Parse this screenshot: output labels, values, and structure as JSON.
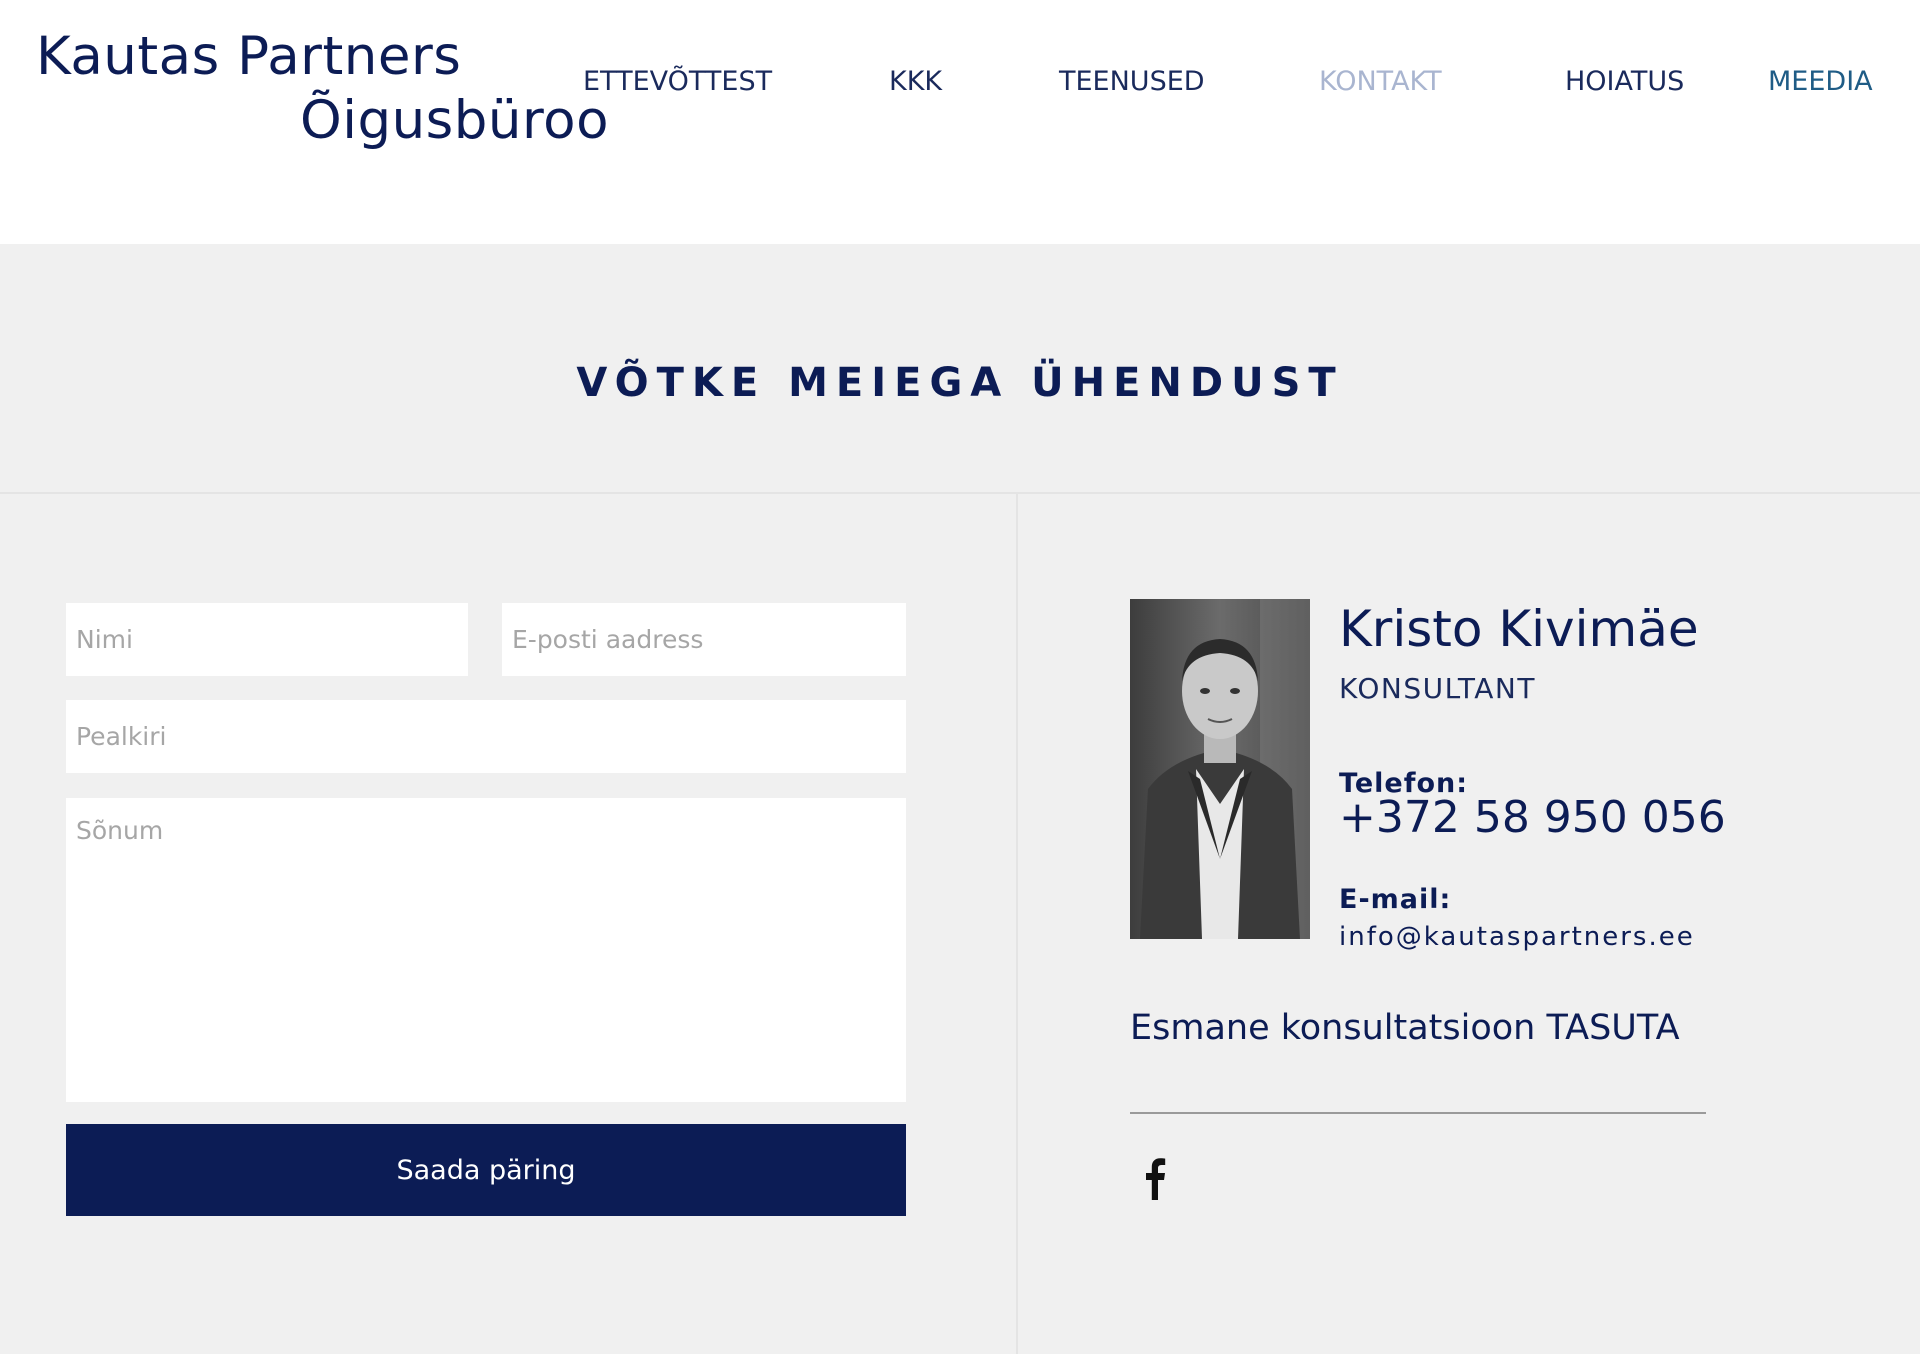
{
  "brand": {
    "line1": "Kautas Partners",
    "line2": "Õigusbüroo"
  },
  "nav": {
    "items": [
      {
        "label": "ETTEVÕTTEST"
      },
      {
        "label": "KKK"
      },
      {
        "label": "TEENUSED"
      },
      {
        "label": "KONTAKT"
      },
      {
        "label": "HOIATUS"
      },
      {
        "label": "MEEDIA"
      }
    ],
    "active_index": 3
  },
  "section": {
    "title": "VÕTKE MEIEGA ÜHENDUST"
  },
  "form": {
    "name_placeholder": "Nimi",
    "email_placeholder": "E-posti aadress",
    "subject_placeholder": "Pealkiri",
    "message_placeholder": "Sõnum",
    "submit_label": "Saada päring"
  },
  "contact": {
    "name": "Kristo Kivimäe",
    "role": "KONSULTANT",
    "phone_label": "Telefon:",
    "phone": "+372 58 950 056",
    "email_label": "E-mail:",
    "email": "info@kautaspartners.ee",
    "promo": "Esmane konsultatsioon TASUTA",
    "social_icon": "facebook-icon"
  },
  "colors": {
    "brand_navy": "#0c1c55",
    "nav_active": "#a9b5d0",
    "page_background": "#f0f0f0",
    "header_background": "#ffffff"
  }
}
